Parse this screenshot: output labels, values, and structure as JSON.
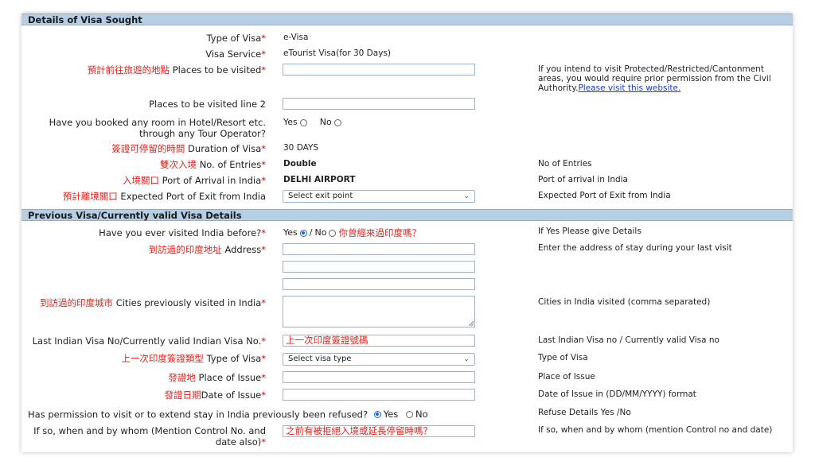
{
  "sections": {
    "visa_sought": "Details of Visa Sought",
    "previous_visa": "Previous Visa/Currently valid Visa Details"
  },
  "fields": {
    "type_of_visa": {
      "label": "Type of Visa",
      "value": "e-Visa"
    },
    "visa_service": {
      "label": "Visa Service",
      "value": "eTourist Visa(for 30 Days)"
    },
    "places_visited": {
      "zh": "預計前往旅遊的地點",
      "label": "Places to be visited",
      "value": "",
      "help": "If you intend to visit Protected/Restricted/Cantonment areas, you would require prior permission from the Civil Authority.",
      "help_link": "Please visit this website."
    },
    "places_visited_2": {
      "label": "Places to be visited line 2",
      "value": ""
    },
    "booked_room": {
      "label_line1": "Have you booked any room in Hotel/Resort etc.",
      "label_line2": "through any Tour Operator?",
      "yes": "Yes",
      "no": "No"
    },
    "duration": {
      "zh": "簽證可停留的時間",
      "label": "Duration of Visa",
      "value": "30 DAYS"
    },
    "entries": {
      "zh": "雙次入境",
      "label": "No. of Entries",
      "value": "Double",
      "help": "No of Entries"
    },
    "port_arrival": {
      "zh": "入境關口",
      "label": "Port of Arrival in India",
      "value": "DELHI AIRPORT",
      "help": "Port of arrival in India"
    },
    "port_exit": {
      "zh": "預計離境關口",
      "label": "Expected Port of Exit from India",
      "selected": "Select exit point",
      "help": "Expected Port of Exit from India"
    },
    "visited_before": {
      "label": "Have you ever visited India before?",
      "yes": "Yes",
      "no": "No",
      "zh": "你曾經來過印度嗎？",
      "help": "If Yes Please give Details"
    },
    "address": {
      "zh": "到訪過的印度地址",
      "label": "Address",
      "help": "Enter the address of stay during your last visit"
    },
    "cities": {
      "zh": "到訪過的印度城市",
      "label": "Cities previously visited in India",
      "help": "Cities in India visited (comma separated)"
    },
    "last_visa_no": {
      "label": "Last Indian Visa No/Currently valid Indian Visa No.",
      "value": "上一次印度簽證號碼",
      "help": "Last Indian Visa no / Currently valid Visa no"
    },
    "prev_visa_type": {
      "zh": "上一次印度簽證類型",
      "label": "Type of Visa",
      "selected": "Select visa type",
      "help": "Type of Visa"
    },
    "place_issue": {
      "zh": "發證地",
      "label": "Place of Issue",
      "help": "Place of Issue"
    },
    "date_issue": {
      "zh": "發證日期",
      "label": "Date of Issue",
      "help": "Date of Issue in (DD/MM/YYYY) format"
    },
    "refused": {
      "label": "Has permission to visit or to extend stay in India previously been refused?",
      "yes": "Yes",
      "no": "No",
      "help": "Refuse Details Yes /No"
    },
    "refused_details": {
      "label_line1": "If so, when and by whom (Mention Control No. and",
      "label_line2": "date also)",
      "value": "之前有被拒絕入境或延長停留時嗎？",
      "help": "If so, when and by whom (mention Control no and date)"
    }
  },
  "required_marker": "*",
  "colors": {
    "section_bg": "#b6cfe5",
    "annotation_red": "#e0201a",
    "radio_selected": "#1a66d6",
    "link": "#1a3cc8"
  }
}
